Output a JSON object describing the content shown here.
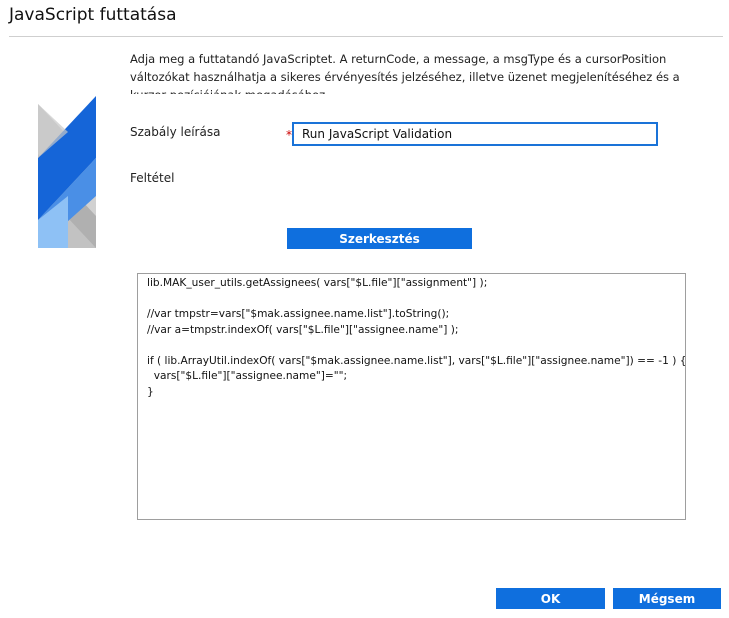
{
  "dialog": {
    "title": "JavaScript futtatása",
    "description": "Adja meg a futtatandó JavaScriptet. A returnCode, a message, a msgType és a cursorPosition változókat használhatja a sikeres érvényesítés jelzéséhez, illetve üzenet megjelenítéséhez és a kurzor pozíciójának megadásához."
  },
  "form": {
    "rule_label": "Szabály leírása",
    "required_marker": "*",
    "rule_value": "Run JavaScript Validation",
    "condition_label": "Feltétel",
    "edit_button": "Szerkesztés"
  },
  "code": {
    "lines": [
      "lib.MAK_user_utils.getAssignees( vars[\"$L.file\"][\"assignment\"] );",
      "",
      "//var tmpstr=vars[\"$mak.assignee.name.list\"].toString();",
      "//var a=tmpstr.indexOf( vars[\"$L.file\"][\"assignee.name\"] );",
      "",
      "if ( lib.ArrayUtil.indexOf( vars[\"$mak.assignee.name.list\"], vars[\"$L.file\"][\"assignee.name\"]) == -1 ) {",
      "  vars[\"$L.file\"][\"assignee.name\"]=\"\";",
      "}"
    ]
  },
  "footer": {
    "ok_label": "OK",
    "cancel_label": "Mégsem"
  },
  "colors": {
    "accent": "#0f6fde",
    "input_border": "#1a73d8",
    "logo_dark_blue": "#1565d8",
    "logo_light_blue": "#8ec1f5",
    "logo_gray": "#9a9a9a"
  }
}
